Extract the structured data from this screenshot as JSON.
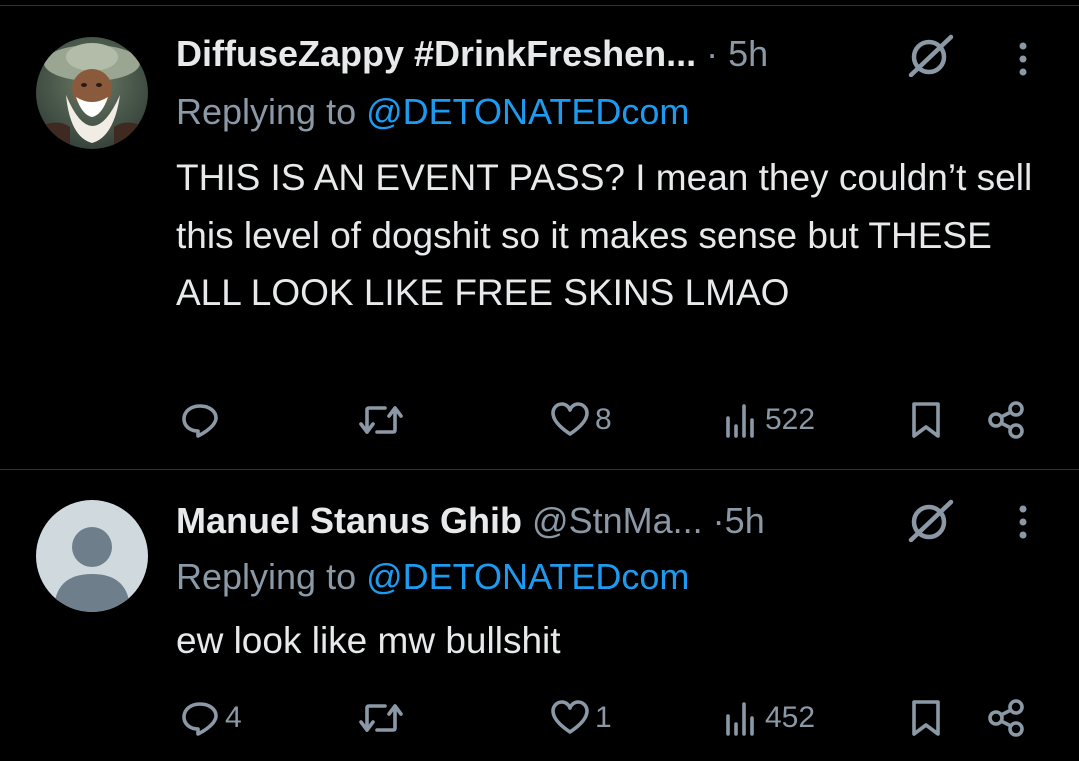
{
  "tweets": [
    {
      "display_name": "DiffuseZappy #DrinkFreshen...",
      "handle": "",
      "dot": "·",
      "time": "5h",
      "replying_prefix": "Replying to",
      "replying_to": "@DETONATEDcom",
      "text": "THIS IS AN EVENT PASS? I mean they couldn’t sell this level of dogshit so it makes sense but THESE ALL LOOK LIKE FREE SKINS LMAO",
      "counts": {
        "replies": "",
        "retweets": "",
        "likes": "8",
        "views": "522"
      },
      "avatar": "bearded-man-photo"
    },
    {
      "display_name": "Manuel Stanus Ghib",
      "handle": "@StnMa...",
      "dot": "·",
      "time": "5h",
      "replying_prefix": "Replying to",
      "replying_to": "@DETONATEDcom",
      "text": "ew look like mw bullshit",
      "counts": {
        "replies": "4",
        "retweets": "",
        "likes": "1",
        "views": "452"
      },
      "avatar": "default-profile"
    }
  ],
  "icons": {
    "grok": "grok-icon",
    "more": "more-vertical-icon",
    "reply": "reply-icon",
    "retweet": "retweet-icon",
    "like": "heart-icon",
    "views": "views-chart-icon",
    "bookmark": "bookmark-icon",
    "share": "share-icon"
  },
  "colors": {
    "background": "#000000",
    "text_primary": "#e7e9ea",
    "text_secondary": "#8b98a5",
    "link": "#1d9bf0",
    "divider": "#2f3336"
  }
}
